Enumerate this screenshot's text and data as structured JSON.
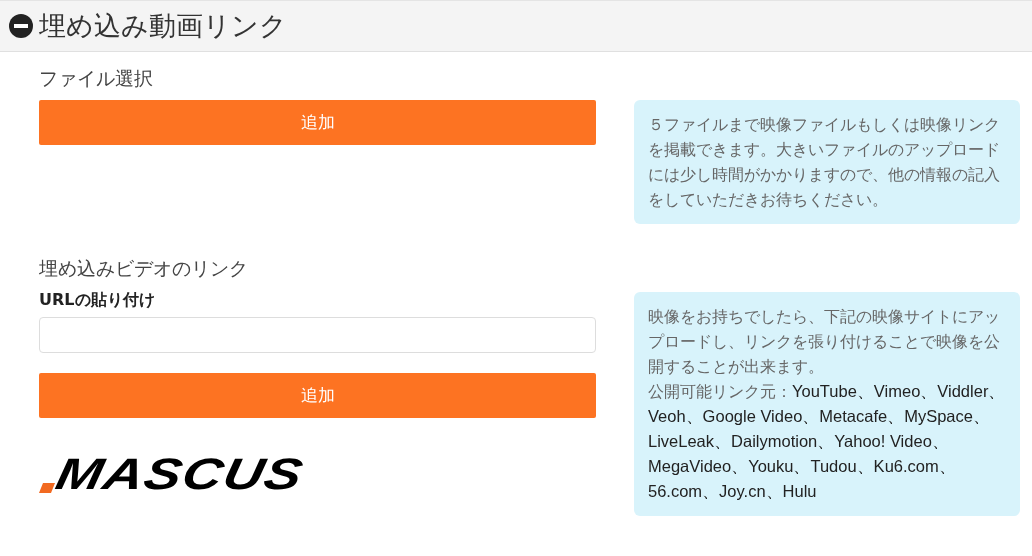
{
  "section": {
    "title": "埋め込み動画リンク",
    "expanded": true
  },
  "file_select": {
    "label": "ファイル選択",
    "button": "追加",
    "info": "５ファイルまで映像ファイルもしくは映像リンクを掲載できます。大きいファイルのアップロードには少し時間がかかりますので、他の情報の記入をしていただきお待ちください。"
  },
  "video_link": {
    "label": "埋め込みビデオのリンク",
    "field_label": "URLの貼り付け",
    "button": "追加",
    "logo": "MASCUS",
    "info": {
      "text": "映像をお持ちでしたら、下記の映像サイトにアップロードし、リンクを張り付けることで映像を公開することが出来ます。",
      "sources_label": "公開可能リンク元：",
      "sources": "YouTube、Vimeo、Viddler、Veoh、Google Video、Metacafe、MySpace、LiveLeak、Dailymotion、Yahoo! Video、MegaVideo、Youku、Tudou、Ku6.com、56.com、Joy.cn、Hulu"
    }
  }
}
